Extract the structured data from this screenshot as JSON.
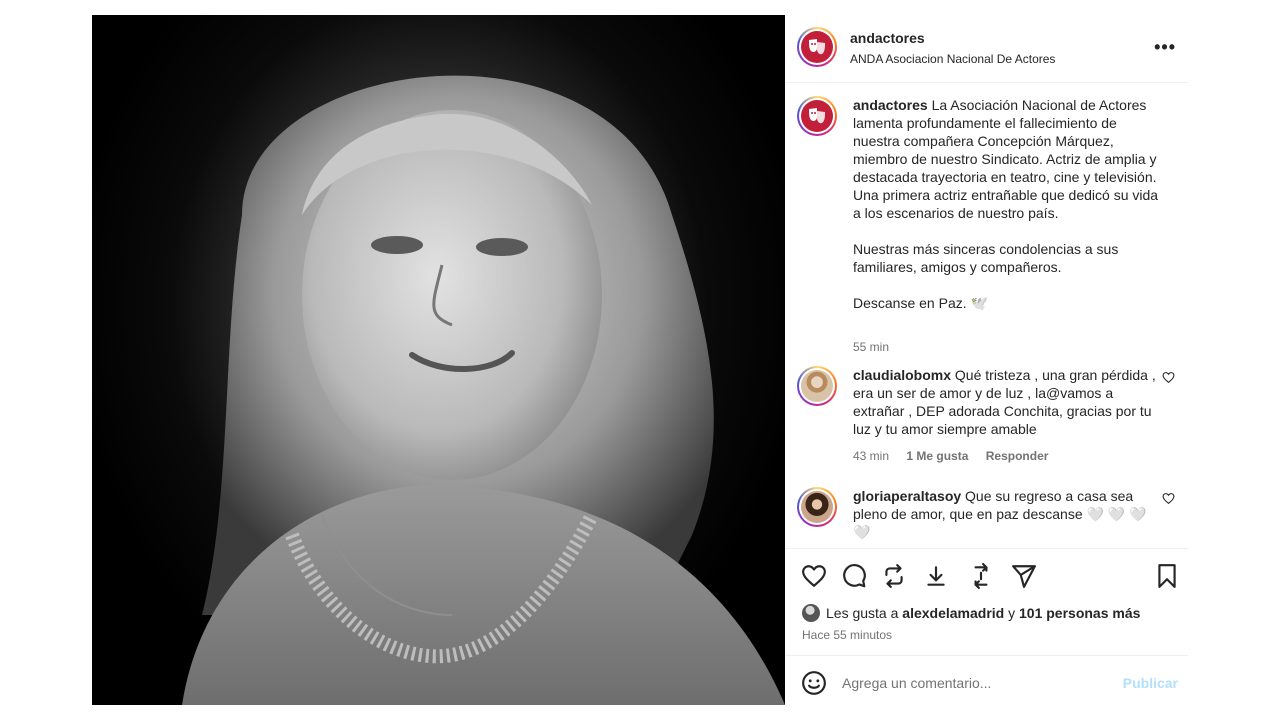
{
  "post": {
    "username": "andactores",
    "account_name": "ANDA Asociacion Nacional De Actores",
    "more_icon": "more-options-icon",
    "caption_lines": [
      "La Asociación Nacional de Actores",
      "lamenta profundamente el fallecimiento de",
      "nuestra compañera Concepción Márquez,",
      "miembro de nuestro Sindicato. Actriz de amplia y",
      "destacada trayectoria en teatro, cine y televisión.",
      "Una primera actriz entrañable que dedicó su vida",
      "a los escenarios de nuestro país."
    ],
    "caption_para2_lines": [
      "Nuestras más sinceras condolencias a sus",
      "familiares, amigos y compañeros."
    ],
    "caption_para3": "Descanse en Paz. 🕊️",
    "caption_time": "55 min"
  },
  "comments": [
    {
      "username": "claudialobomx",
      "text_lines": [
        "Qué tristeza , una gran pérdida ,",
        "era un ser de amor y de luz , la@vamos a",
        "extrañar , DEP adorada Conchita, gracias por tu",
        "luz y tu amor siempre amable"
      ],
      "time": "43 min",
      "likes": "1 Me gusta",
      "reply": "Responder"
    },
    {
      "username": "gloriaperaltasoy",
      "text_lines": [
        "Que su regreso a casa sea",
        "pleno de amor, que en paz descanse 🤍 🤍 🤍",
        "🤍"
      ]
    }
  ],
  "likes": {
    "prefix": "Les gusta a",
    "user": "alexdelamadrid",
    "joiner": "y",
    "others": "101 personas más"
  },
  "posted_ago": "Hace 55 minutos",
  "composer": {
    "placeholder": "Agrega un comentario...",
    "publish_label": "Publicar"
  },
  "colors": {
    "brand_logo": "#c21f3a",
    "link_disabled": "#b2dffc",
    "muted": "#737373"
  }
}
